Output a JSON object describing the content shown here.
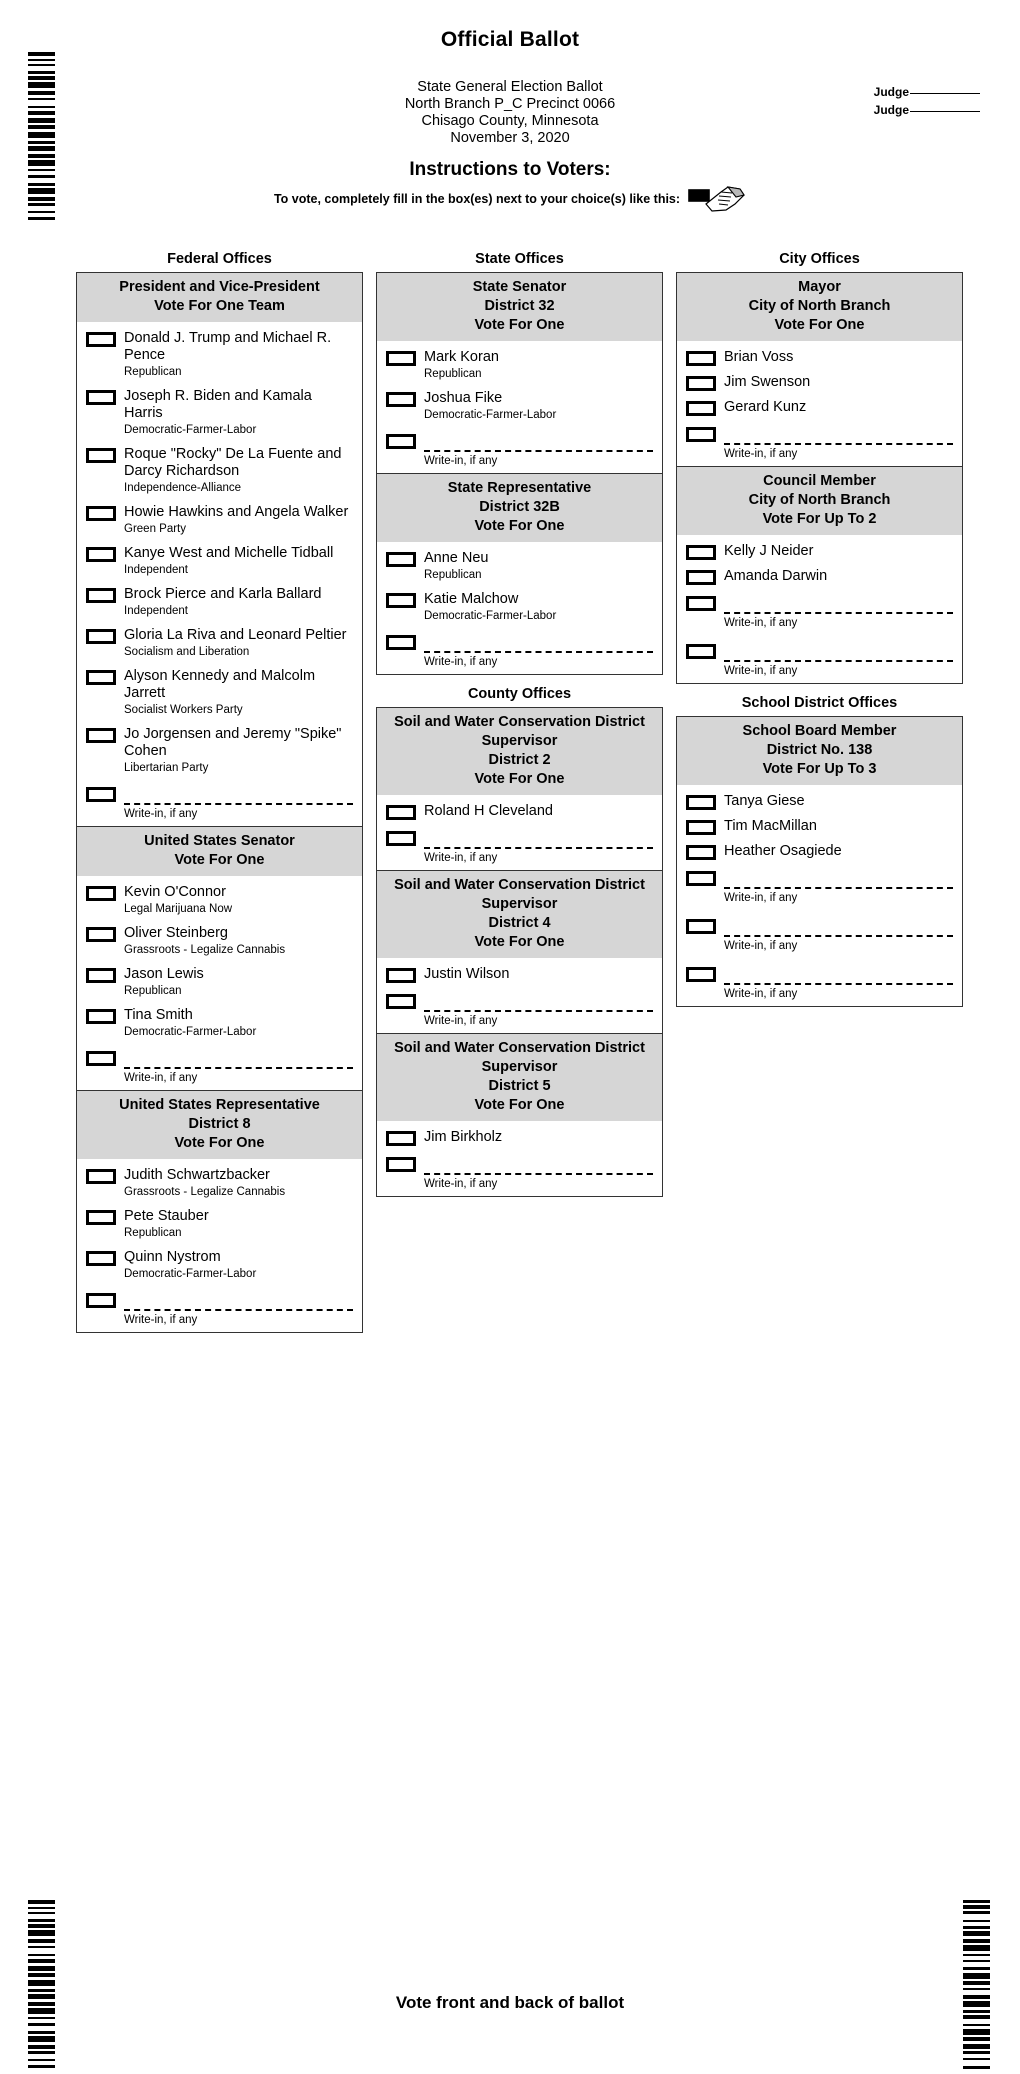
{
  "header": {
    "title": "Official Ballot",
    "election_lines": [
      "State General Election Ballot",
      "North Branch P_C Precinct 0066",
      "Chisago County, Minnesota",
      "November 3, 2020"
    ],
    "instructions_title": "Instructions to Voters:",
    "instructions_text": "To vote, completely fill in the box(es) next to your choice(s) like this:",
    "judge_label_1": "Judge",
    "judge_label_2": "Judge"
  },
  "footer": {
    "note": "Vote front and back of ballot"
  },
  "labels": {
    "write_in": "Write-in, if any"
  },
  "columns": [
    {
      "name": "federal",
      "groups": [
        {
          "heading": "Federal Offices",
          "contests": [
            {
              "title": "President and Vice-President",
              "instruction": "Vote For One Team",
              "district": null,
              "choices": [
                {
                  "name": "Donald J. Trump and Michael R. Pence",
                  "party": "Republican"
                },
                {
                  "name": "Joseph R. Biden and Kamala Harris",
                  "party": "Democratic-Farmer-Labor"
                },
                {
                  "name": "Roque \"Rocky\" De La Fuente and Darcy Richardson",
                  "party": "Independence-Alliance"
                },
                {
                  "name": "Howie Hawkins and Angela Walker",
                  "party": "Green Party"
                },
                {
                  "name": "Kanye West and Michelle Tidball",
                  "party": "Independent"
                },
                {
                  "name": "Brock Pierce and Karla Ballard",
                  "party": "Independent"
                },
                {
                  "name": "Gloria La Riva and Leonard Peltier",
                  "party": "Socialism and Liberation"
                },
                {
                  "name": "Alyson Kennedy and Malcolm Jarrett",
                  "party": "Socialist Workers Party"
                },
                {
                  "name": "Jo Jorgensen and Jeremy \"Spike\" Cohen",
                  "party": "Libertarian Party"
                }
              ],
              "write_ins": 1
            },
            {
              "title": "United States Senator",
              "instruction": "Vote For One",
              "district": null,
              "choices": [
                {
                  "name": "Kevin O'Connor",
                  "party": "Legal Marijuana Now"
                },
                {
                  "name": "Oliver Steinberg",
                  "party": "Grassroots - Legalize Cannabis"
                },
                {
                  "name": "Jason Lewis",
                  "party": "Republican"
                },
                {
                  "name": "Tina Smith",
                  "party": "Democratic-Farmer-Labor"
                }
              ],
              "write_ins": 1
            },
            {
              "title": "United States Representative",
              "instruction": "Vote For One",
              "district": "District 8",
              "choices": [
                {
                  "name": "Judith Schwartzbacker",
                  "party": "Grassroots - Legalize Cannabis"
                },
                {
                  "name": "Pete Stauber",
                  "party": "Republican"
                },
                {
                  "name": "Quinn Nystrom",
                  "party": "Democratic-Farmer-Labor"
                }
              ],
              "write_ins": 1
            }
          ]
        }
      ]
    },
    {
      "name": "state",
      "groups": [
        {
          "heading": "State Offices",
          "contests": [
            {
              "title": "State Senator",
              "instruction": "Vote For One",
              "district": "District 32",
              "choices": [
                {
                  "name": "Mark Koran",
                  "party": "Republican"
                },
                {
                  "name": "Joshua Fike",
                  "party": "Democratic-Farmer-Labor"
                }
              ],
              "write_ins": 1
            },
            {
              "title": "State Representative",
              "instruction": "Vote For One",
              "district": "District 32B",
              "choices": [
                {
                  "name": "Anne Neu",
                  "party": "Republican"
                },
                {
                  "name": "Katie Malchow",
                  "party": "Democratic-Farmer-Labor"
                }
              ],
              "write_ins": 1
            }
          ]
        },
        {
          "heading": "County Offices",
          "contests": [
            {
              "title": "Soil and Water Conservation District Supervisor",
              "instruction": "Vote For One",
              "district": "District 2",
              "choices": [
                {
                  "name": "Roland H Cleveland",
                  "party": null
                }
              ],
              "write_ins": 1
            },
            {
              "title": "Soil and Water Conservation District Supervisor",
              "instruction": "Vote For One",
              "district": "District 4",
              "choices": [
                {
                  "name": "Justin Wilson",
                  "party": null
                }
              ],
              "write_ins": 1
            },
            {
              "title": "Soil and Water Conservation District Supervisor",
              "instruction": "Vote For One",
              "district": "District 5",
              "choices": [
                {
                  "name": "Jim Birkholz",
                  "party": null
                }
              ],
              "write_ins": 1
            }
          ]
        }
      ]
    },
    {
      "name": "city",
      "groups": [
        {
          "heading": "City Offices",
          "contests": [
            {
              "title": "Mayor",
              "instruction": "Vote For One",
              "district": "City of North Branch",
              "choices": [
                {
                  "name": "Brian Voss",
                  "party": null
                },
                {
                  "name": "Jim Swenson",
                  "party": null
                },
                {
                  "name": "Gerard Kunz",
                  "party": null
                }
              ],
              "write_ins": 1
            },
            {
              "title": "Council Member",
              "instruction": "Vote For Up To 2",
              "district": "City of North Branch",
              "choices": [
                {
                  "name": "Kelly J Neider",
                  "party": null
                },
                {
                  "name": "Amanda Darwin",
                  "party": null
                }
              ],
              "write_ins": 2
            }
          ]
        },
        {
          "heading": "School District Offices",
          "contests": [
            {
              "title": "School Board Member",
              "instruction": "Vote For Up To 3",
              "district": "District No. 138",
              "choices": [
                {
                  "name": "Tanya Giese",
                  "party": null
                },
                {
                  "name": "Tim MacMillan",
                  "party": null
                },
                {
                  "name": "Heather Osagiede",
                  "party": null
                }
              ],
              "write_ins": 3
            }
          ]
        }
      ]
    }
  ],
  "barcodes": {
    "top_left": [
      4,
      3,
      2,
      3,
      2,
      5,
      3,
      2,
      4,
      2,
      6,
      3,
      4,
      3,
      2,
      6,
      2,
      3,
      4,
      3,
      5,
      2,
      4,
      3,
      6,
      3,
      3,
      2,
      5,
      3,
      4,
      2,
      6,
      3,
      2,
      4,
      3,
      5,
      3,
      2,
      6,
      3,
      4,
      2,
      3,
      5,
      2,
      4,
      3,
      6
    ],
    "bottom_left": [
      4,
      3,
      2,
      3,
      2,
      5,
      3,
      2,
      4,
      2,
      6,
      3,
      4,
      3,
      2,
      6,
      2,
      3,
      4,
      3,
      5,
      2,
      4,
      3,
      6,
      3,
      3,
      2,
      5,
      3,
      4,
      2,
      6,
      3,
      2,
      4,
      3,
      5,
      3,
      2,
      6,
      3,
      4,
      2,
      3,
      5,
      2,
      4,
      3,
      6
    ],
    "bottom_right": [
      3,
      2,
      4,
      2,
      3,
      6,
      2,
      4,
      3,
      2,
      5,
      3,
      4,
      2,
      6,
      3,
      2,
      4,
      2,
      5,
      3,
      3,
      6,
      2,
      4,
      3,
      2,
      5,
      4,
      2,
      6,
      3,
      3,
      2,
      4,
      5,
      2,
      3,
      6,
      2,
      4,
      3,
      5,
      2,
      3,
      4,
      2,
      6,
      3,
      3
    ]
  },
  "colors": {
    "contest_header_bg": "#d6d6d6",
    "border": "#333333",
    "rule": "#555555",
    "ink": "#000000",
    "page": "#ffffff"
  }
}
